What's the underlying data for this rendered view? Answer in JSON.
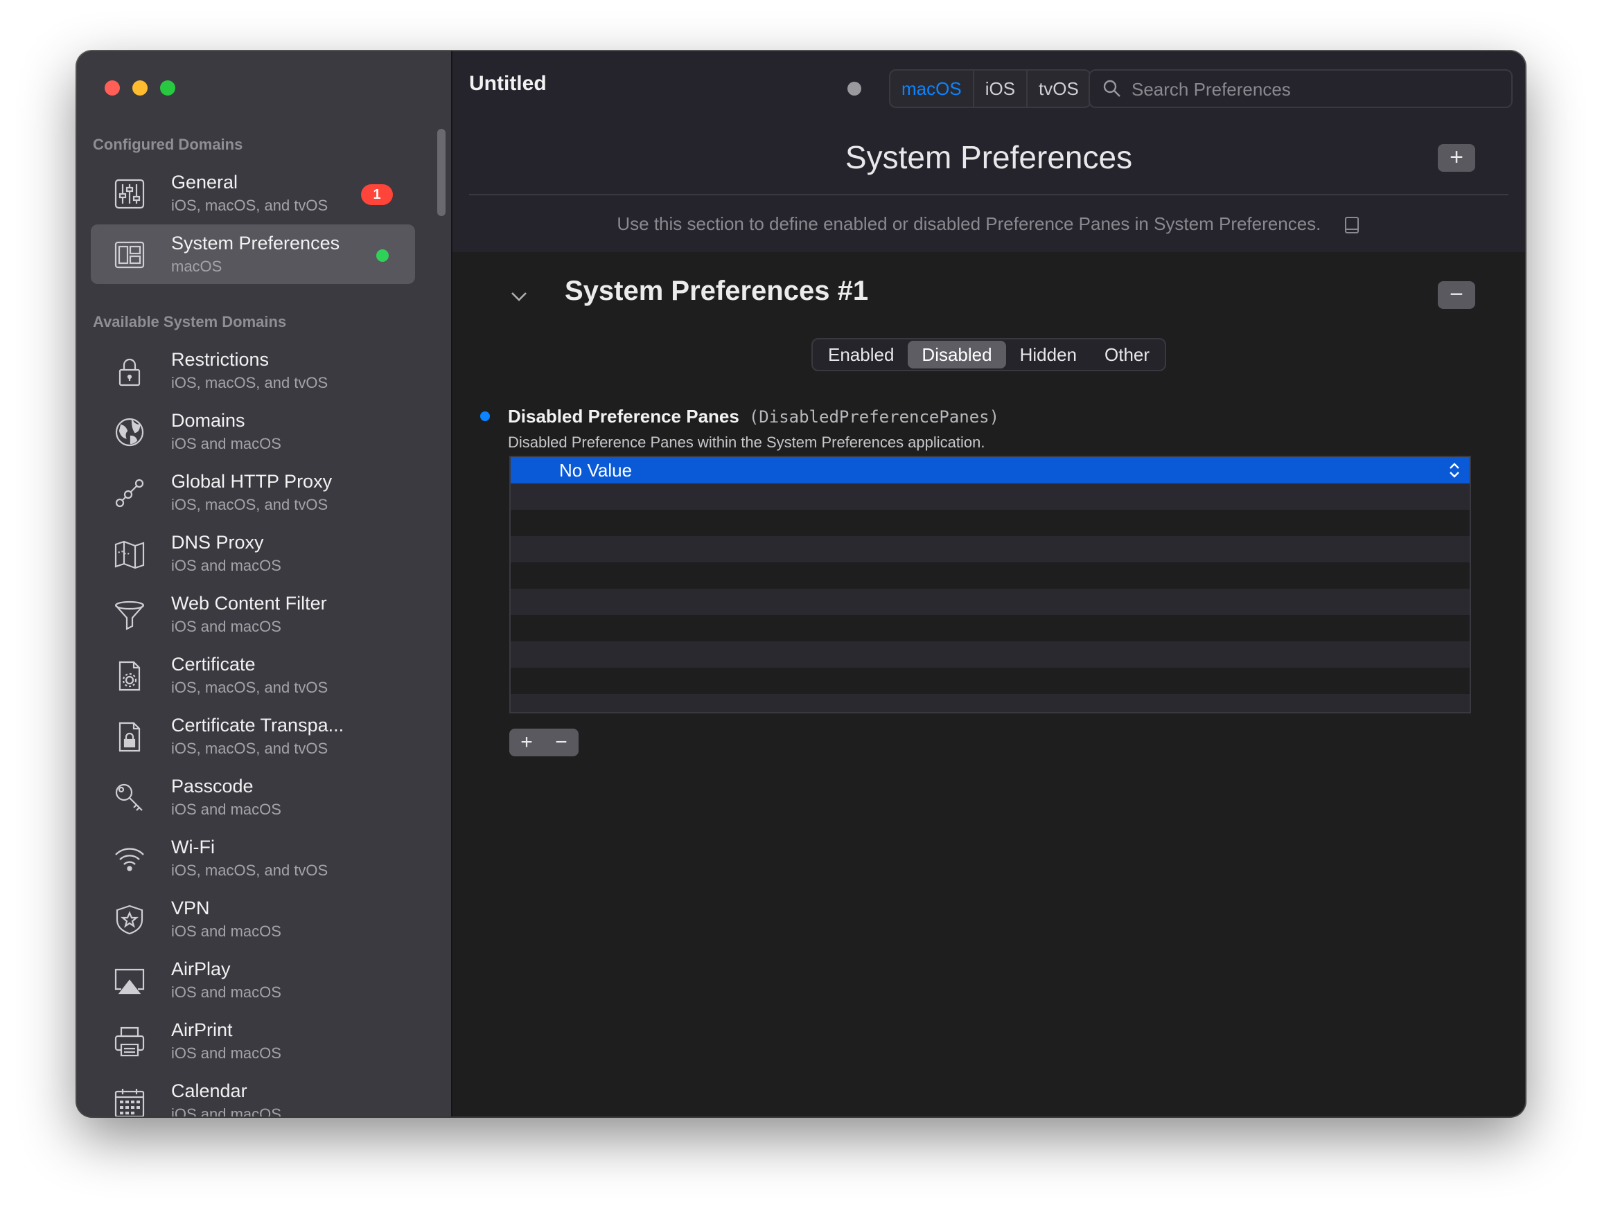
{
  "window": {
    "title": "Untitled"
  },
  "sidebar": {
    "configured_title": "Configured Domains",
    "configured": [
      {
        "name": "General",
        "sub": "iOS, macOS, and tvOS",
        "icon": "sliders-icon",
        "badge": "1"
      },
      {
        "name": "System Preferences",
        "sub": "macOS",
        "icon": "preference-pane-icon",
        "status": "green"
      }
    ],
    "available_title": "Available System Domains",
    "available": [
      {
        "name": "Restrictions",
        "sub": "iOS, macOS, and tvOS",
        "icon": "lock-icon"
      },
      {
        "name": "Domains",
        "sub": "iOS and macOS",
        "icon": "globe-icon"
      },
      {
        "name": "Global HTTP Proxy",
        "sub": "iOS, macOS, and tvOS",
        "icon": "proxy-nodes-icon"
      },
      {
        "name": "DNS Proxy",
        "sub": "iOS and macOS",
        "icon": "map-icon"
      },
      {
        "name": "Web Content Filter",
        "sub": "iOS and macOS",
        "icon": "funnel-icon"
      },
      {
        "name": "Certificate",
        "sub": "iOS, macOS, and tvOS",
        "icon": "certificate-gear-icon"
      },
      {
        "name": "Certificate Transpa...",
        "sub": "iOS, macOS, and tvOS",
        "icon": "certificate-lock-icon"
      },
      {
        "name": "Passcode",
        "sub": "iOS and macOS",
        "icon": "key-icon"
      },
      {
        "name": "Wi-Fi",
        "sub": "iOS, macOS, and tvOS",
        "icon": "wifi-icon"
      },
      {
        "name": "VPN",
        "sub": "iOS and macOS",
        "icon": "shield-star-icon"
      },
      {
        "name": "AirPlay",
        "sub": "iOS and macOS",
        "icon": "airplay-icon"
      },
      {
        "name": "AirPrint",
        "sub": "iOS and macOS",
        "icon": "printer-icon"
      },
      {
        "name": "Calendar",
        "sub": "iOS and macOS",
        "icon": "calendar-icon"
      }
    ]
  },
  "toolbar": {
    "platforms": [
      "macOS",
      "iOS",
      "tvOS"
    ],
    "active_platform": "macOS",
    "search_placeholder": "Search Preferences"
  },
  "pane": {
    "title": "System Preferences",
    "add_label": "+",
    "description": "Use this section to define enabled or disabled Preference Panes in System Preferences.",
    "section_title": "System Preferences #1",
    "remove_label": "−",
    "tabs": [
      "Enabled",
      "Disabled",
      "Hidden",
      "Other"
    ],
    "active_tab": "Disabled",
    "pref": {
      "name": "Disabled Preference Panes",
      "key": "(DisabledPreferencePanes)",
      "description": "Disabled Preference Panes within the System Preferences application.",
      "selected_value": "No Value"
    },
    "list_add_label": "+",
    "list_remove_label": "−"
  },
  "colors": {
    "accent": "#0a84ff",
    "badge": "#ff453a",
    "status_ok": "#30d158",
    "selection": "#0a5ad8"
  }
}
